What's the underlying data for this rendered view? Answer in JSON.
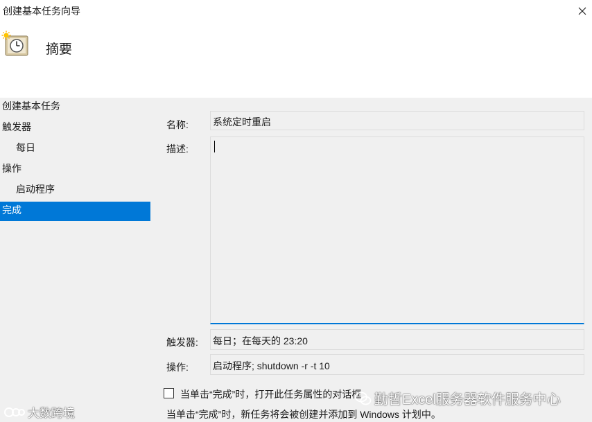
{
  "window": {
    "title": "创建基本任务向导",
    "heading": "摘要"
  },
  "nav": {
    "items": [
      {
        "label": "创建基本任务"
      },
      {
        "label": "触发器"
      },
      {
        "label": "每日"
      },
      {
        "label": "操作"
      },
      {
        "label": "启动程序"
      },
      {
        "label": "完成"
      }
    ]
  },
  "form": {
    "name_label": "名称:",
    "name_value": "系统定时重启",
    "desc_label": "描述:",
    "desc_value": "",
    "trigger_label": "触发器:",
    "trigger_value": "每日；在每天的 23:20",
    "action_label": "操作:",
    "action_value": "启动程序; shutdown -r -t 10"
  },
  "footer": {
    "checkbox_label": "当单击“完成”时，打开此任务属性的对话框",
    "checkbox_checked": false,
    "note": "当单击“完成”时，新任务将会被创建并添加到 Windows 计划中。"
  },
  "watermarks": {
    "left": "大数跨境",
    "right": "勤哲Excel服务器软件服务中心"
  },
  "colors": {
    "selection": "#0078d7",
    "background": "#f0f0f0",
    "header": "#ffffff"
  }
}
